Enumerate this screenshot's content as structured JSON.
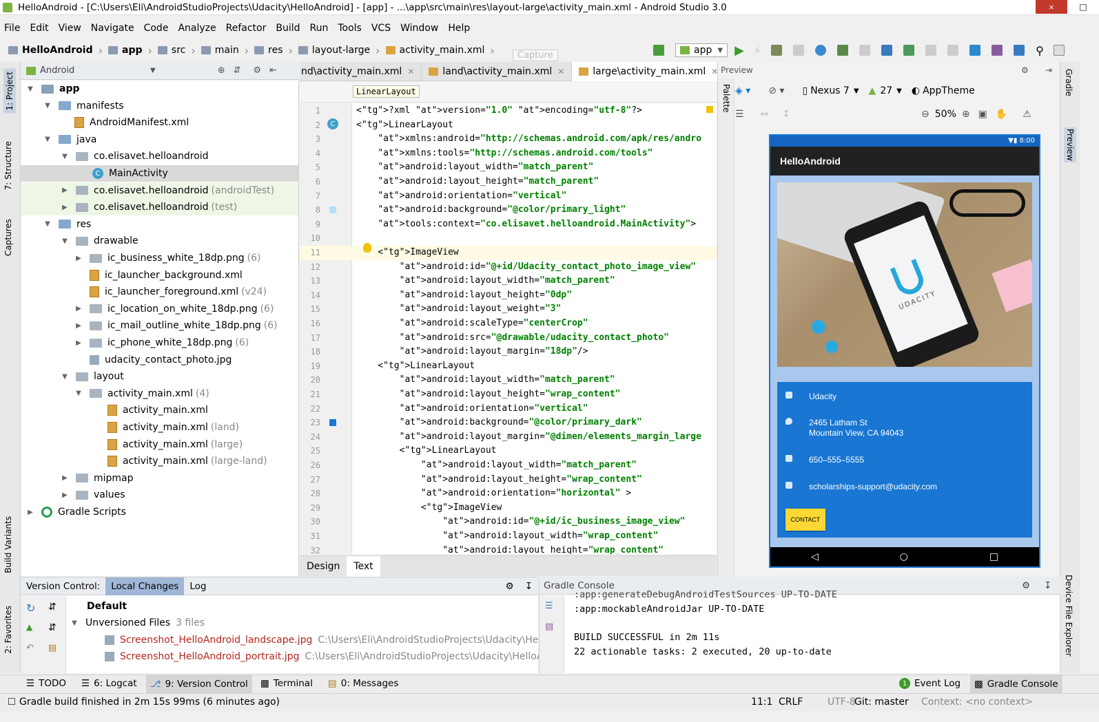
{
  "window": {
    "title": "HelloAndroid - [C:\\Users\\Eli\\AndroidStudioProjects\\Udacity\\HelloAndroid] - [app] - ...\\app\\src\\main\\res\\layout-large\\activity_main.xml - Android Studio 3.0"
  },
  "menu": [
    "File",
    "Edit",
    "View",
    "Navigate",
    "Code",
    "Analyze",
    "Refactor",
    "Build",
    "Run",
    "Tools",
    "VCS",
    "Window",
    "Help"
  ],
  "breadcrumb": [
    "HelloAndroid",
    "app",
    "src",
    "main",
    "res",
    "layout-large",
    "activity_main.xml"
  ],
  "run_config": "app",
  "tooltip": "Capture",
  "project": {
    "view": "Android",
    "tree": [
      {
        "label": "app",
        "extra": ""
      },
      {
        "label": "manifests",
        "extra": ""
      },
      {
        "label": "AndroidManifest.xml",
        "extra": ""
      },
      {
        "label": "java",
        "extra": ""
      },
      {
        "label": "co.elisavet.helloandroid",
        "extra": ""
      },
      {
        "label": "MainActivity",
        "extra": ""
      },
      {
        "label": "co.elisavet.helloandroid",
        "extra": "(androidTest)"
      },
      {
        "label": "co.elisavet.helloandroid",
        "extra": "(test)"
      },
      {
        "label": "res",
        "extra": ""
      },
      {
        "label": "drawable",
        "extra": ""
      },
      {
        "label": "ic_business_white_18dp.png",
        "extra": "(6)"
      },
      {
        "label": "ic_launcher_background.xml",
        "extra": ""
      },
      {
        "label": "ic_launcher_foreground.xml",
        "extra": "(v24)"
      },
      {
        "label": "ic_location_on_white_18dp.png",
        "extra": "(6)"
      },
      {
        "label": "ic_mail_outline_white_18dp.png",
        "extra": "(6)"
      },
      {
        "label": "ic_phone_white_18dp.png",
        "extra": "(6)"
      },
      {
        "label": "udacity_contact_photo.jpg",
        "extra": ""
      },
      {
        "label": "layout",
        "extra": ""
      },
      {
        "label": "activity_main.xml",
        "extra": "(4)"
      },
      {
        "label": "activity_main.xml",
        "extra": ""
      },
      {
        "label": "activity_main.xml",
        "extra": "(land)"
      },
      {
        "label": "activity_main.xml",
        "extra": "(large)"
      },
      {
        "label": "activity_main.xml",
        "extra": "(large-land)"
      },
      {
        "label": "mipmap",
        "extra": ""
      },
      {
        "label": "values",
        "extra": ""
      },
      {
        "label": "Gradle Scripts",
        "extra": ""
      }
    ]
  },
  "editor_tabs": [
    "nd\\activity_main.xml",
    "land\\activity_main.xml",
    "large\\activity_main.xml"
  ],
  "editor_crumb": "LinearLayout",
  "code_lines": [
    "<?xml version=\"1.0\" encoding=\"utf-8\"?>",
    "<LinearLayout",
    "    xmlns:android=\"http://schemas.android.com/apk/res/andro",
    "    xmlns:tools=\"http://schemas.android.com/tools\"",
    "    android:layout_width=\"match_parent\"",
    "    android:layout_height=\"match_parent\"",
    "    android:orientation=\"vertical\"",
    "    android:background=\"@color/primary_light\"",
    "    tools:context=\"co.elisavet.helloandroid.MainActivity\">",
    "",
    "    <ImageView",
    "        android:id=\"@+id/Udacity_contact_photo_image_view\"",
    "        android:layout_width=\"match_parent\"",
    "        android:layout_height=\"0dp\"",
    "        android:layout_weight=\"3\"",
    "        android:scaleType=\"centerCrop\"",
    "        android:src=\"@drawable/udacity_contact_photo\"",
    "        android:layout_margin=\"18dp\"/>",
    "    <LinearLayout",
    "        android:layout_width=\"match_parent\"",
    "        android:layout_height=\"wrap_content\"",
    "        android:orientation=\"vertical\"",
    "        android:background=\"@color/primary_dark\"",
    "        android:layout_margin=\"@dimen/elements_margin_large",
    "        <LinearLayout",
    "            android:layout_width=\"match_parent\"",
    "            android:layout_height=\"wrap_content\"",
    "            android:orientation=\"horizontal\" >",
    "            <ImageView",
    "                android:id=\"@+id/ic_business_image_view\"",
    "                android:layout_width=\"wrap_content\"",
    "                android:layout_height=\"wrap_content\""
  ],
  "design_tabs": [
    "Design",
    "Text"
  ],
  "preview": {
    "title": "Preview",
    "palette": "Palette",
    "device": "Nexus 7",
    "api": "27",
    "theme": "AppTheme",
    "zoom": "50%",
    "status_time": "8:00",
    "app_title": "HelloAndroid",
    "photo_brand": "UDACITY",
    "contact": {
      "name": "Udacity",
      "address1": "2465 Latham St",
      "address2": "Mountain View, CA 94043",
      "phone": "650–555–5555",
      "email": "scholarships-support@udacity.com",
      "button": "CONTACT"
    }
  },
  "version_control": {
    "label": "Version Control:",
    "tabs": [
      "Local Changes",
      "Log"
    ],
    "changelist": "Default",
    "group": "Unversioned Files",
    "group_count": "3 files",
    "files": [
      {
        "name": "Screenshot_HelloAndroid_landscape.jpg",
        "path": "C:\\Users\\Eli\\AndroidStudioProjects\\Udacity\\HelloA"
      },
      {
        "name": "Screenshot_HelloAndroid_portrait.jpg",
        "path": "C:\\Users\\Eli\\AndroidStudioProjects\\Udacity\\HelloAnd"
      }
    ]
  },
  "gradle": {
    "title": "Gradle Console",
    "lines": [
      ":app:generateDebugAndroidTestSources UP-TO-DATE",
      ":app:mockableAndroidJar UP-TO-DATE",
      "",
      "BUILD SUCCESSFUL in 2m 11s",
      "22 actionable tasks: 2 executed, 20 up-to-date"
    ]
  },
  "left_tabs": [
    "1: Project",
    "7: Structure",
    "Captures",
    "Build Variants",
    "2: Favorites"
  ],
  "right_tabs": [
    "Gradle",
    "Preview",
    "Device File Explorer"
  ],
  "tool_windows": [
    "TODO",
    "6: Logcat",
    "9: Version Control",
    "Terminal",
    "0: Messages"
  ],
  "right_tools": {
    "event_log_count": "1",
    "event_log": "Event Log",
    "gradle_console": "Gradle Console"
  },
  "status": {
    "message": "Gradle build finished in 2m 15s 99ms (6 minutes ago)",
    "position": "11:1",
    "line_sep": "CRLF",
    "encoding": "UTF-8",
    "git": "Git: master",
    "context": "Context: <no context>"
  }
}
